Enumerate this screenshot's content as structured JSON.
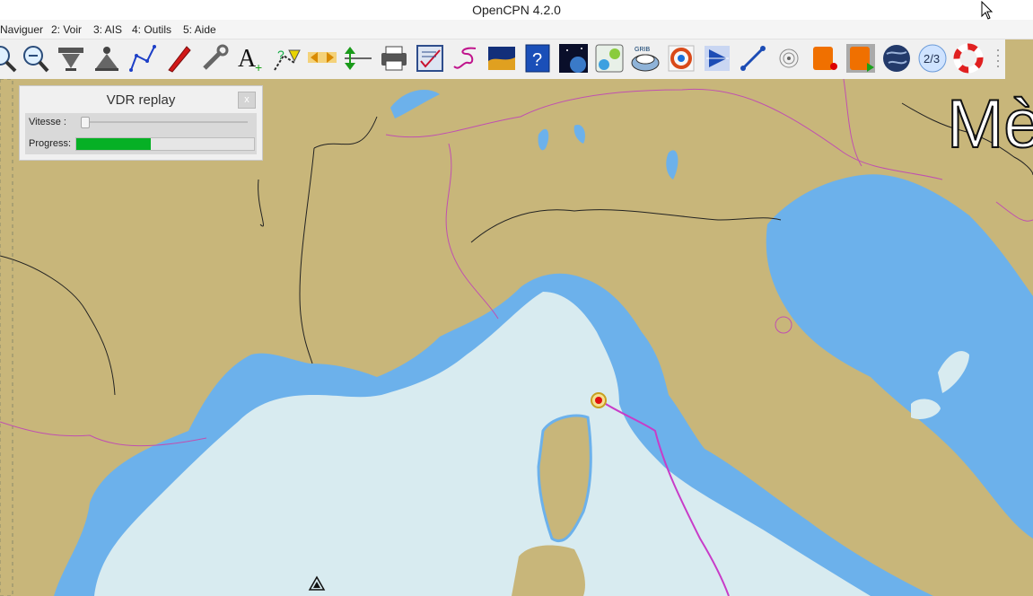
{
  "window": {
    "title": "OpenCPN 4.2.0"
  },
  "menubar": [
    {
      "label": "Naviguer"
    },
    {
      "label": "2: Voir"
    },
    {
      "label": "3: AIS"
    },
    {
      "label": "4: Outils"
    },
    {
      "label": "5: Aide"
    }
  ],
  "toolbar": [
    {
      "name": "zoom-in-icon"
    },
    {
      "name": "zoom-out-icon"
    },
    {
      "name": "chart-scale-down-icon"
    },
    {
      "name": "chart-scale-up-icon"
    },
    {
      "name": "create-route-icon"
    },
    {
      "name": "auto-follow-boat-icon"
    },
    {
      "name": "settings-wrench-icon"
    },
    {
      "name": "text-overlay-icon"
    },
    {
      "name": "current-icon"
    },
    {
      "name": "tide-icon"
    },
    {
      "name": "course-up-icon"
    },
    {
      "name": "print-icon"
    },
    {
      "name": "route-manager-icon"
    },
    {
      "name": "track-icon"
    },
    {
      "name": "colour-scheme-icon"
    },
    {
      "name": "help-icon"
    },
    {
      "name": "sky-night-icon"
    },
    {
      "name": "dashboard-icon"
    },
    {
      "name": "grib-icon"
    },
    {
      "name": "vdr-icon"
    },
    {
      "name": "play-icon"
    },
    {
      "name": "measure-icon"
    },
    {
      "name": "radar-icon"
    },
    {
      "name": "record-icon"
    },
    {
      "name": "replay-icon"
    },
    {
      "name": "globe-icon"
    },
    {
      "name": "two-three-icon",
      "text": "2/3"
    },
    {
      "name": "lifebuoy-icon"
    }
  ],
  "chart": {
    "label_fragment": "Mè",
    "colors": {
      "land": "#c8b67a",
      "shallow": "#6cb1eb",
      "deep": "#d8ebf0",
      "route": "#c83cc8",
      "border": "#c050b0"
    }
  },
  "vdr": {
    "title": "VDR replay",
    "close": "x",
    "speed_label": "Vitesse :",
    "progress_label": "Progress:",
    "speed_value": 0.0,
    "progress_value": 0.42
  }
}
